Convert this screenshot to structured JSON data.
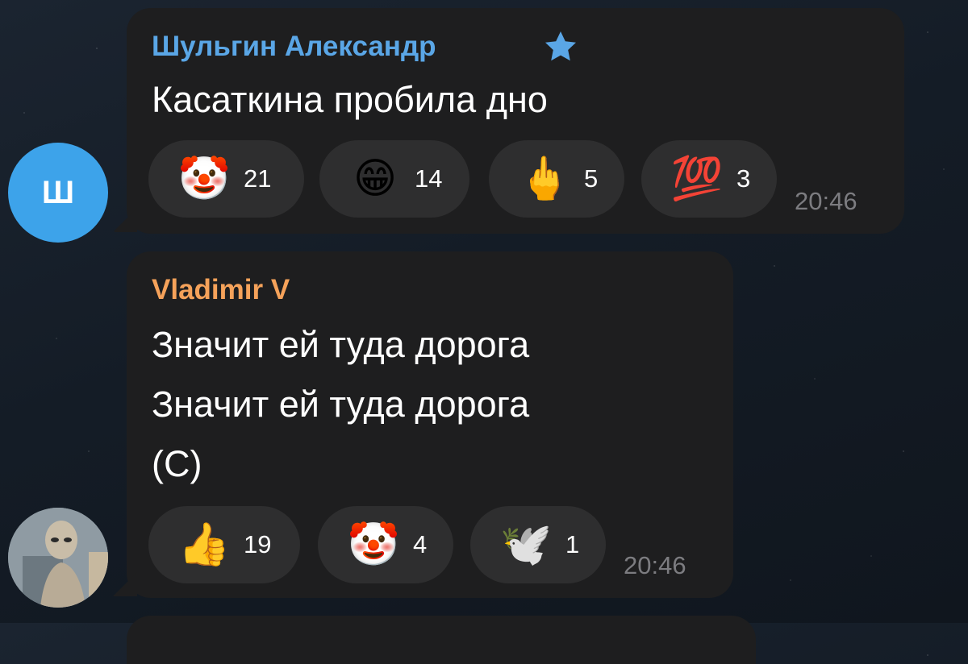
{
  "messages": [
    {
      "avatar_letter": "Ш",
      "sender": "Шульгин Александр",
      "sender_color": "#5aa6e6",
      "premium_icon": "star-icon",
      "text_lines": [
        "Касаткина пробила дно"
      ],
      "reactions": [
        {
          "emoji": "🤡",
          "icon": "clown-face-icon",
          "count": "21"
        },
        {
          "emoji": "😁",
          "icon": "grinning-face-icon",
          "count": "14"
        },
        {
          "emoji": "🖕",
          "icon": "middle-finger-icon",
          "count": "5"
        },
        {
          "emoji": "💯",
          "icon": "hundred-points-icon",
          "count": "3"
        }
      ],
      "time": "20:46"
    },
    {
      "avatar_icon": "alien-photo-avatar",
      "sender": "Vladimir V",
      "sender_color": "#f5a25a",
      "text_lines": [
        "Значит ей туда дорога",
        "Значит ей туда дорога",
        "(С)"
      ],
      "reactions": [
        {
          "emoji": "👍",
          "icon": "thumbs-up-icon",
          "count": "19"
        },
        {
          "emoji": "🤡",
          "icon": "clown-face-icon",
          "count": "4"
        },
        {
          "emoji": "🕊️",
          "icon": "dove-icon",
          "count": "1"
        }
      ],
      "time": "20:46"
    }
  ]
}
